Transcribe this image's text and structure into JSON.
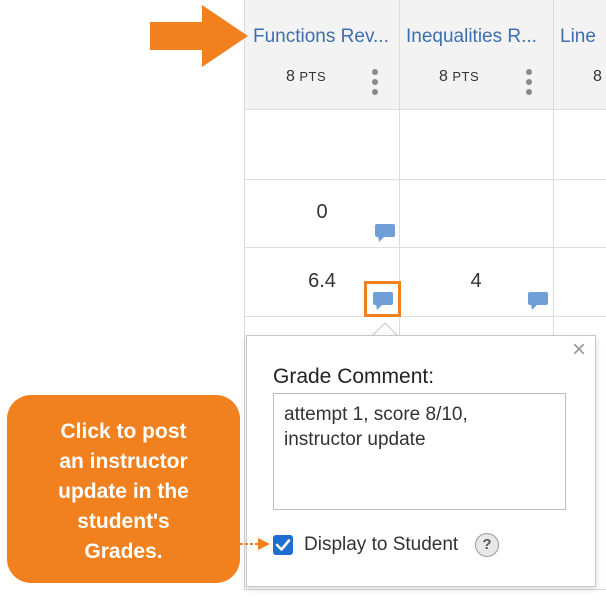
{
  "gradebook": {
    "columns": [
      {
        "title": "Functions Rev...",
        "points_value": "8",
        "points_unit": "PTS"
      },
      {
        "title": "Inequalities R...",
        "points_value": "8",
        "points_unit": "PTS"
      },
      {
        "title": "Line",
        "points_value": "8"
      }
    ],
    "rows": [
      {
        "col1": "",
        "col2": ""
      },
      {
        "col1": "0",
        "col2": ""
      },
      {
        "col1": "6.4",
        "col2": "4"
      }
    ]
  },
  "comment_popup": {
    "close_symbol": "×",
    "label": "Grade Comment:",
    "comment_text": "attempt 1, score 8/10,\ninstructor update",
    "display_checkbox_label": "Display to Student",
    "display_checked": true,
    "help_symbol": "?"
  },
  "callout": {
    "text": "Click to post\nan instructor\nupdate in the\nstudent's\nGrades."
  },
  "colors": {
    "accent_orange": "#f0811e",
    "link_blue": "#3d6fb0",
    "bubble_blue": "#6f9fd6",
    "checkbox_blue": "#1f6fd0"
  }
}
